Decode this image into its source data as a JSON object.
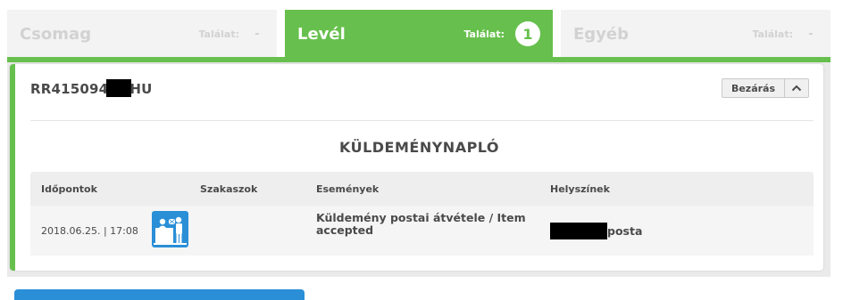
{
  "tabs": [
    {
      "name": "Csomag",
      "hits_label": "Találat:",
      "hits_value": "-"
    },
    {
      "name": "Levél",
      "hits_label": "Találat:",
      "hits_value": "1"
    },
    {
      "name": "Egyéb",
      "hits_label": "Találat:",
      "hits_value": "-"
    }
  ],
  "colors": {
    "accent_green": "#67c04d",
    "accent_blue": "#2a8fd7",
    "text": "#4a4a4a"
  },
  "item": {
    "tracking_prefix": "RR415094",
    "tracking_suffix": "HU",
    "close_label": "Bezárás",
    "close_icon": "chevron-up-icon"
  },
  "log": {
    "title": "KÜLDEMÉNYNAPLÓ",
    "columns": [
      "Időpontok",
      "Szakaszok",
      "Események",
      "Helyszínek"
    ],
    "rows": [
      {
        "time": "2018.06.25. | 17:08",
        "stage_icon": "postal-counter-icon",
        "event": "Küldemény postai átvétele / Item accepted",
        "location_suffix": "posta"
      }
    ]
  }
}
